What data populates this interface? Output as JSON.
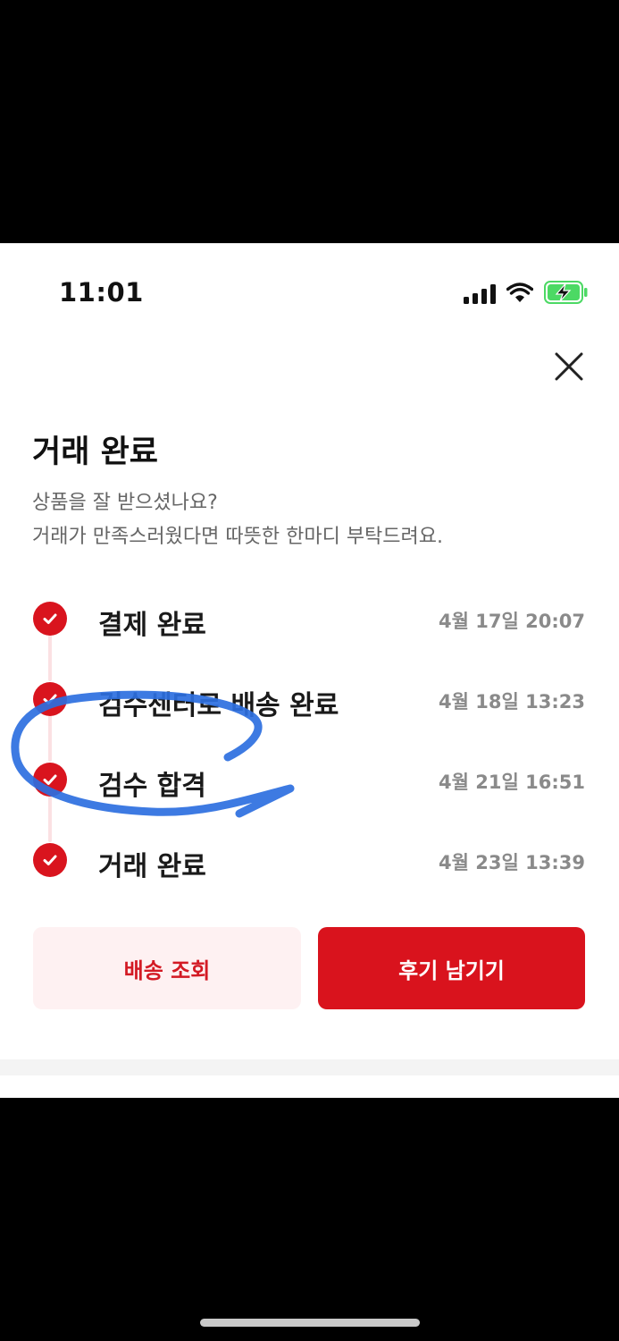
{
  "status_bar": {
    "time": "11:01",
    "icons": [
      "cellular-signal-icon",
      "wifi-icon",
      "battery-charging-icon"
    ],
    "battery_color": "#4cd964"
  },
  "header": {
    "close_icon": "close-icon",
    "title": "거래 완료",
    "subtitle_line1": "상품을 잘 받으셨나요?",
    "subtitle_line2": "거래가 만족스러웠다면 따뜻한 한마디 부탁드려요."
  },
  "timeline": {
    "steps": [
      {
        "label": "결제 완료",
        "date": "4월 17일 20:07"
      },
      {
        "label": "검수센터로 배송 완료",
        "date": "4월 18일 13:23"
      },
      {
        "label": "검수 합격",
        "date": "4월 21일 16:51"
      },
      {
        "label": "거래 완료",
        "date": "4월 23일 13:39"
      }
    ]
  },
  "actions": {
    "track_label": "배송 조회",
    "review_label": "후기 남기기"
  },
  "colors": {
    "accent": "#d9141e",
    "accent_light": "#fef1f2",
    "annotation": "#2c6fe0"
  }
}
